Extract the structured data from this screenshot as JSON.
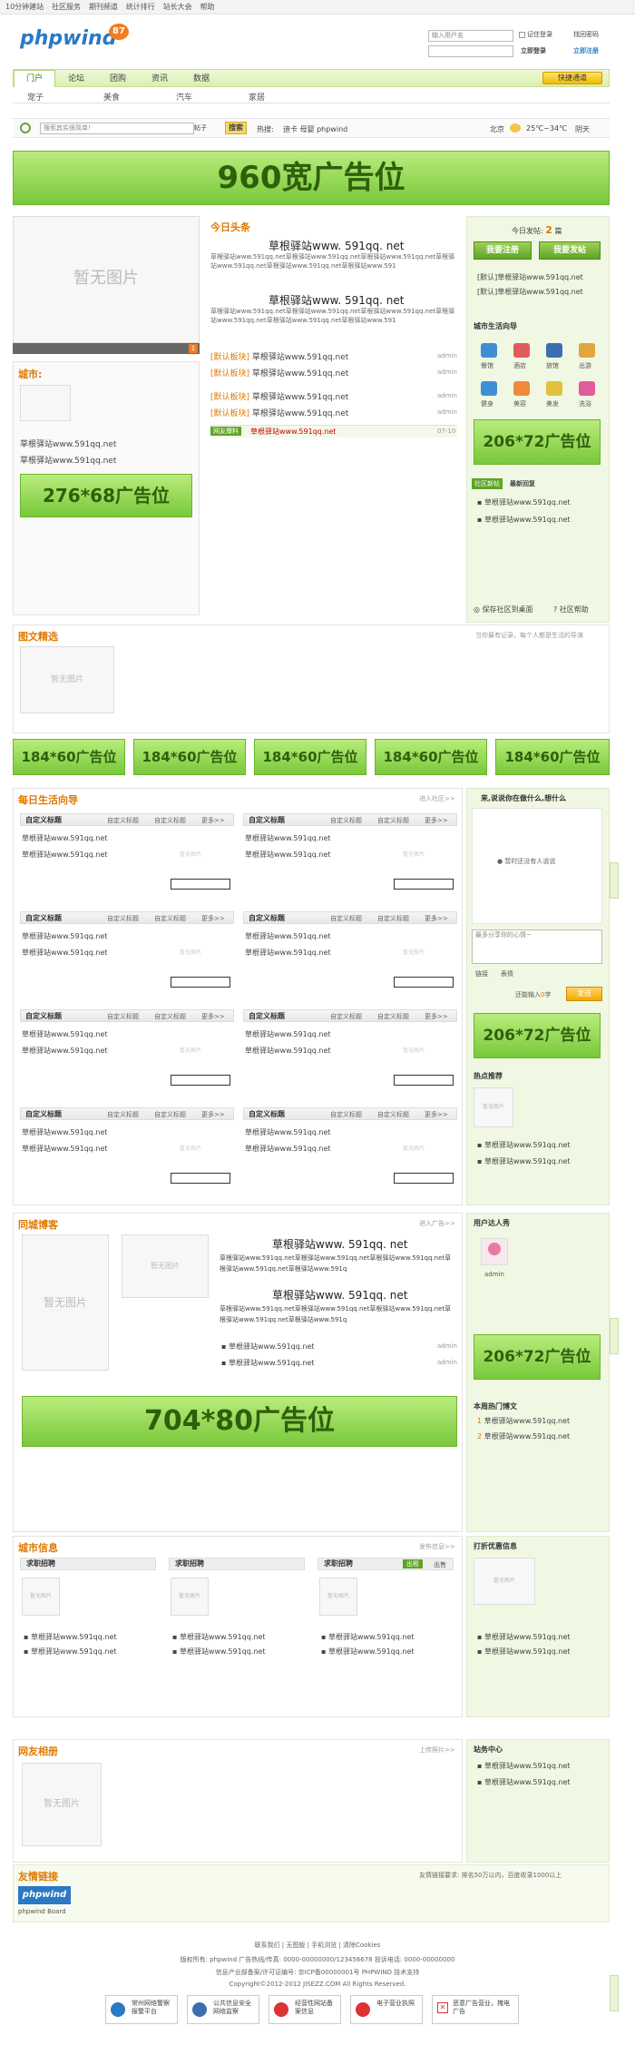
{
  "topbar": [
    "10分钟建站",
    "社区服务",
    "期刊频道",
    "统计排行",
    "站长大会",
    "帮助"
  ],
  "header": {
    "logo": "phpwind",
    "badge": "87",
    "user_placeholder": "输入用户名",
    "remember": "记住登录",
    "forgot": "找回密码",
    "login": "立即登录",
    "register": "立即注册"
  },
  "nav": {
    "items": [
      "门户",
      "论坛",
      "团购",
      "资讯",
      "数据"
    ],
    "sub": [
      "宠子",
      "美食",
      "汽车",
      "家居"
    ],
    "quick": "快捷通道"
  },
  "search": {
    "placeholder": "搜索其实很简单！",
    "type": "帖子",
    "button": "搜索",
    "hot_label": "热搜:",
    "hot": "迪卡 母婴 phpwind",
    "city": "北京",
    "temp": "25℃~34℃",
    "weather": "阴天"
  },
  "ads": {
    "top": "960宽广告位",
    "left": "276*68广告位",
    "right1": "206*72广告位",
    "row": [
      "184*60广告位",
      "184*60广告位",
      "184*60广告位",
      "184*60广告位",
      "184*60广告位"
    ],
    "right2": "206*72广告位",
    "right3": "206*72广告位",
    "wide": "704*80广告位"
  },
  "no_image": "暂无图片",
  "no_image_small": "暂无图片",
  "headlines": {
    "title": "今日头条",
    "h1": "草根驿站www. 591qq. net",
    "text1": "草根驿站www.591qq.net草根驿站www.591qq.net草根驿站www.591qq.net草根驿站www.591qq.net草根驿站www.591qq.net草根驿站www.591",
    "h2": "草根驿站www. 591qq. net",
    "text2": "草根驿站www.591qq.net草根驿站www.591qq.net草根驿站www.591qq.net草根驿站www.591qq.net草根驿站www.591qq.net草根驿站www.591",
    "items": [
      {
        "tag": "[默认板块]",
        "text": "草根驿站www.591qq.net",
        "who": "admin"
      },
      {
        "tag": "[默认板块]",
        "text": "草根驿站www.591qq.net",
        "who": "admin"
      },
      {
        "tag": "[默认板块]",
        "text": "草根驿站www.591qq.net",
        "who": "admin"
      },
      {
        "tag": "[默认板块]",
        "text": "草根驿站www.591qq.net",
        "who": "admin"
      }
    ],
    "notice_tag": "网友爆料",
    "notice_text": "草根驿站www.591qq.net",
    "notice_date": "07-10",
    "page": "1"
  },
  "city": {
    "title": "城市:",
    "items": [
      "草根驿站www.591qq.net",
      "草根驿站www.591qq.net"
    ]
  },
  "sidebar": {
    "today_label": "今日发帖:",
    "today_count": "2",
    "today_unit": "篇",
    "btn_register": "我要注册",
    "btn_post": "我要发帖",
    "posts": [
      "[默认]草根驿站www.591qq.net",
      "[默认]草根驿站www.591qq.net"
    ],
    "guide_title": "城市生活向导",
    "guide": [
      "餐馆",
      "酒店",
      "旅馆",
      "出游",
      "健身",
      "美容",
      "美发",
      "洗浴"
    ],
    "tabs": [
      "社区新帖",
      "最新回复"
    ],
    "new_posts": [
      "草根驿站www.591qq.net",
      "草根驿站www.591qq.net"
    ],
    "save": "保存社区到桌面",
    "help": "社区帮助"
  },
  "gallery": {
    "title": "图文精选",
    "hint": "当你最有记录，每个人都是生活的导演"
  },
  "life": {
    "title": "每日生活向导",
    "more": "进入社区>>",
    "blocks": [
      {
        "title": "自定义标题",
        "links": [
          "自定义标题",
          "自定义标题",
          "更多>>"
        ],
        "items": [
          "草根驿站www.591qq.net",
          "草根驿站www.591qq.net"
        ]
      }
    ],
    "block_count": 8
  },
  "mood": {
    "title": "来,说说你在做什么,想什么",
    "empty": "暂时还没有人说说",
    "placeholder": "最多分享你的心情~",
    "link": "链接",
    "emoji": "表情",
    "count_label": "还能输入",
    "count": "0",
    "count_unit": "字",
    "submit": "发送"
  },
  "hot": {
    "title": "热点推荐",
    "items": [
      "草根驿站www.591qq.net",
      "草根驿站www.591qq.net"
    ]
  },
  "blog": {
    "title": "同城博客",
    "more": "进入广告>>",
    "h1": "草根驿站www. 591qq. net",
    "t1": "草根驿站www.591qq.net草根驿站www.591qq.net草根驿站www.591qq.net草根驿站www.591qq.net草根驿站www.591q",
    "h2": "草根驿站www. 591qq. net",
    "t2": "草根驿站www.591qq.net草根驿站www.591qq.net草根驿站www.591qq.net草根驿站www.591qq.net草根驿站www.591q",
    "items": [
      {
        "text": "草根驿站www.591qq.net",
        "who": "admin"
      },
      {
        "text": "草根驿站www.591qq.net",
        "who": "admin"
      }
    ]
  },
  "users": {
    "title": "用户达人秀",
    "name": "admin"
  },
  "week": {
    "title": "本周热门博文",
    "items": [
      "草根驿站www.591qq.net",
      "草根驿站www.591qq.net"
    ]
  },
  "cityinfo": {
    "title": "城市信息",
    "more": "发布信息>>",
    "cols": [
      "求职招聘",
      "求职招聘",
      "求职招聘"
    ],
    "tabs": [
      "出租",
      "出售"
    ],
    "items": [
      "草根驿站www.591qq.net",
      "草根驿站www.591qq.net"
    ]
  },
  "discount": {
    "title": "打折优惠信息",
    "items": [
      "草根驿站www.591qq.net",
      "草根驿站www.591qq.net"
    ]
  },
  "album": {
    "title": "网友相册",
    "more": "上传照片>>"
  },
  "station": {
    "title": "站务中心",
    "items": [
      "草根驿站www.591qq.net",
      "草根驿站www.591qq.net"
    ]
  },
  "friends": {
    "title": "友情链接",
    "note": "友情链接要求: 排名50万以内，百度收录1000以上",
    "logo": "phpwind",
    "label": "phpwind Board"
  },
  "footer": {
    "links": [
      "联系我们",
      "无图版",
      "手机浏览",
      "清除Cookies"
    ],
    "l2": "版权所有: phpwind  广告热线/传真: 0000-00000000/123456678  投诉电话: 0000-00000000",
    "l3": "信息产业部备案/许可证编号: 京ICP备00000001号 PHPWIND 技术支持",
    "l4": "Copyright©2012-2012 JISEZZ.COM All Rights Reserved.",
    "badges": [
      "常州网络警察报警平台",
      "公共信息安全网络监察",
      "经营性网站备案信息",
      "电子营业执照",
      "恶意广告营业，掩电广告"
    ]
  },
  "colors": {
    "accent": "#e07a00",
    "green": "#78c83a",
    "sidebar": "#f0f8e3"
  }
}
